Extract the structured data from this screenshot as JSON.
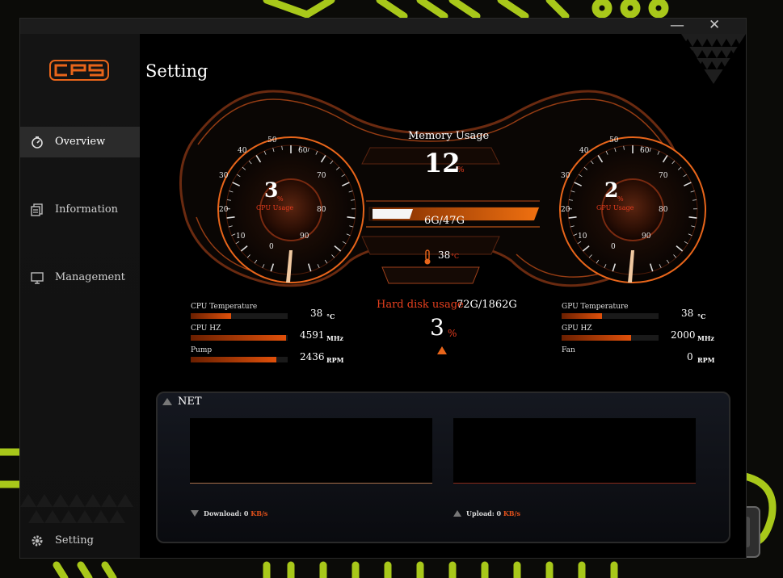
{
  "app": {
    "logo_text": "CPS",
    "page_title": "Setting",
    "window_controls": {
      "minimize": "—",
      "close": "✕"
    }
  },
  "sidebar": {
    "items": [
      {
        "label": "Overview",
        "icon": "gauge-icon",
        "active": true
      },
      {
        "label": "Information",
        "icon": "document-icon",
        "active": false
      },
      {
        "label": "Management",
        "icon": "monitor-icon",
        "active": false
      }
    ],
    "footer": {
      "label": "Setting",
      "icon": "gear-icon"
    }
  },
  "cpu_gauge": {
    "value": "3",
    "unit": "%",
    "label": "CPU Usage",
    "ticks": [
      "0",
      "10",
      "20",
      "30",
      "40",
      "50",
      "60",
      "70",
      "80",
      "90"
    ]
  },
  "gpu_gauge": {
    "value": "2",
    "unit": "%",
    "label": "GPU Usage",
    "ticks": [
      "0",
      "10",
      "20",
      "30",
      "40",
      "50",
      "60",
      "70",
      "80",
      "90"
    ]
  },
  "memory": {
    "title": "Memory Usage",
    "value": "12",
    "unit": "%",
    "used_total": "6G/47G",
    "fraction": 0.12
  },
  "temperature": {
    "value": "38",
    "unit": "°C",
    "icon": "thermometer-icon"
  },
  "hard_disk": {
    "label": "Hard disk usage",
    "used_total": "72G/1862G",
    "value": "3",
    "unit": "%"
  },
  "cpu_stats": [
    {
      "label": "CPU Temperature",
      "value": "38",
      "unit": "°C",
      "fraction": 0.42
    },
    {
      "label": "CPU HZ",
      "value": "4591",
      "unit": "MHz",
      "fraction": 0.98
    },
    {
      "label": "Pump",
      "value": "2436",
      "unit": "RPM",
      "fraction": 0.88
    }
  ],
  "gpu_stats": [
    {
      "label": "GPU Temperature",
      "value": "38",
      "unit": "°C",
      "fraction": 0.42
    },
    {
      "label": "GPU HZ",
      "value": "2000",
      "unit": "MHz",
      "fraction": 0.72
    },
    {
      "label": "Fan",
      "value": "0",
      "unit": "RPM",
      "fraction": 0
    }
  ],
  "net": {
    "title": "NET",
    "download": {
      "label": "Download: ",
      "value": "0",
      "unit": "KB/s"
    },
    "upload": {
      "label": "Upload: ",
      "value": "0",
      "unit": "KB/s"
    }
  },
  "colors": {
    "accent": "#e8651a",
    "accent_red": "#e63c1e",
    "sidebar_active": "#2b2b2b",
    "background_deco": "#a8c81a"
  }
}
